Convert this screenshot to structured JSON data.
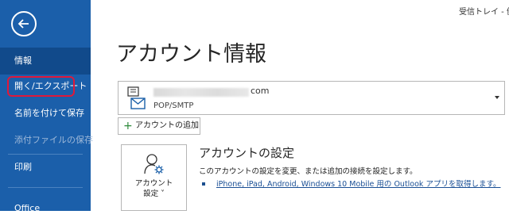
{
  "sidebar": {
    "back_icon": "back-arrow-icon",
    "items": [
      {
        "label": "情報"
      },
      {
        "label": "開く/エクスポート"
      },
      {
        "label": "名前を付けて保存"
      },
      {
        "label": "添付ファイルの保存"
      },
      {
        "label": "印刷"
      },
      {
        "label": "Office"
      }
    ],
    "selected_index": 0,
    "highlighted_index": 1
  },
  "header": {
    "window_title_partial": "受信トレイ - 健"
  },
  "main": {
    "title": "アカウント情報",
    "account": {
      "email_suffix": "com",
      "type": "POP/SMTP"
    },
    "add_account_label": "アカウントの追加",
    "settings_tile_label_line1": "アカウント",
    "settings_tile_label_line2": "設定 ˅",
    "settings_title": "アカウントの設定",
    "settings_desc": "このアカウントの設定を変更、または追加の接続を設定します。",
    "settings_link": "iPhone, iPad, Android, Windows 10 Mobile 用の Outlook アプリを取得します。"
  },
  "colors": {
    "sidebar_bg": "#1b5faa",
    "sidebar_selected": "#114a8b",
    "highlight": "#e0183a",
    "link": "#1a4f95"
  }
}
